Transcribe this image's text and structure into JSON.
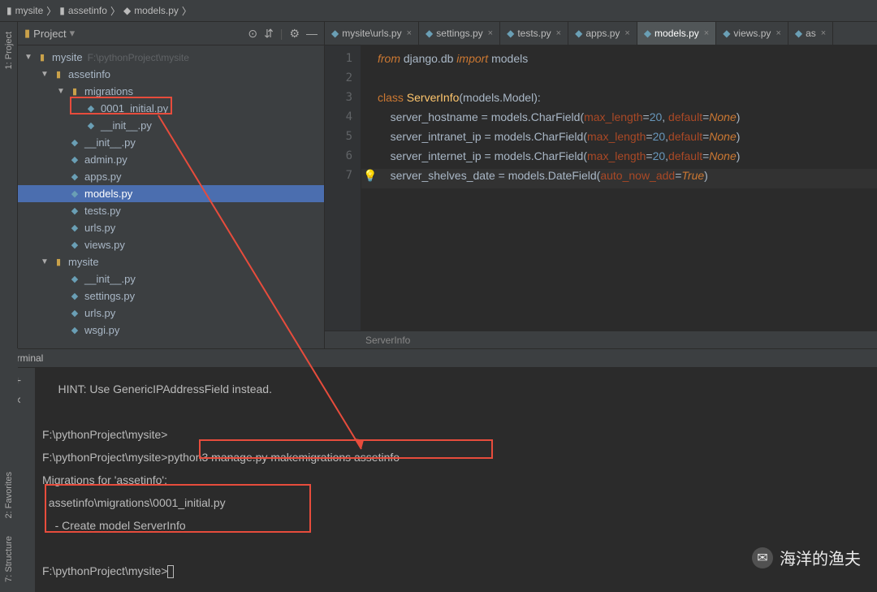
{
  "breadcrumb": [
    "mysite",
    "assetinfo",
    "models.py"
  ],
  "panel": {
    "title": "Project",
    "path_hint": "F:\\pythonProject\\mysite"
  },
  "panel_actions": {
    "target": "⊙",
    "collapse": "⇵",
    "gear": "⚙",
    "min": "—"
  },
  "tree": [
    {
      "d": 1,
      "a": "▼",
      "i": "folder",
      "t": "mysite",
      "hint": "F:\\pythonProject\\mysite"
    },
    {
      "d": 2,
      "a": "▼",
      "i": "folder",
      "t": "assetinfo"
    },
    {
      "d": 3,
      "a": "▼",
      "i": "folder",
      "t": "migrations"
    },
    {
      "d": 4,
      "a": "",
      "i": "py",
      "t": "0001_initial.py",
      "boxed": true
    },
    {
      "d": 4,
      "a": "",
      "i": "py",
      "t": "__init__.py"
    },
    {
      "d": 3,
      "a": "",
      "i": "py",
      "t": "__init__.py"
    },
    {
      "d": 3,
      "a": "",
      "i": "py",
      "t": "admin.py"
    },
    {
      "d": 3,
      "a": "",
      "i": "py",
      "t": "apps.py"
    },
    {
      "d": 3,
      "a": "",
      "i": "py",
      "t": "models.py",
      "sel": true
    },
    {
      "d": 3,
      "a": "",
      "i": "py",
      "t": "tests.py"
    },
    {
      "d": 3,
      "a": "",
      "i": "py",
      "t": "urls.py"
    },
    {
      "d": 3,
      "a": "",
      "i": "py",
      "t": "views.py"
    },
    {
      "d": 2,
      "a": "▼",
      "i": "folder",
      "t": "mysite"
    },
    {
      "d": 3,
      "a": "",
      "i": "py",
      "t": "__init__.py"
    },
    {
      "d": 3,
      "a": "",
      "i": "py",
      "t": "settings.py"
    },
    {
      "d": 3,
      "a": "",
      "i": "py",
      "t": "urls.py"
    },
    {
      "d": 3,
      "a": "",
      "i": "py",
      "t": "wsgi.py"
    }
  ],
  "tabs": [
    {
      "t": "mysite\\urls.py"
    },
    {
      "t": "settings.py"
    },
    {
      "t": "tests.py"
    },
    {
      "t": "apps.py"
    },
    {
      "t": "models.py",
      "active": true
    },
    {
      "t": "views.py"
    },
    {
      "t": "as"
    }
  ],
  "code_lines": 7,
  "code": {
    "l1": {
      "pre": "from ",
      "mod": "django.db ",
      "imp": "import ",
      "name": "models"
    },
    "l3": {
      "cls": "class ",
      "name": "ServerInfo",
      "paren": "(models.Model)",
      ":": ":"
    },
    "l4": {
      "ind": "    ",
      "var": "server_hostname ",
      "eq": "= ",
      "call": "models.",
      "fn": "CharField",
      "open": "(",
      "p1": "max_length",
      "e1": "=",
      "n1": "20",
      "c": ", ",
      "p2": "default",
      "e2": "=",
      "v2": "None",
      "close": ")"
    },
    "l5": {
      "ind": "    ",
      "var": "server_intranet_ip ",
      "eq": "= ",
      "call": "models.",
      "fn": "CharField",
      "open": "(",
      "p1": "max_length",
      "e1": "=",
      "n1": "20",
      "c": ",",
      "p2": "default",
      "e2": "=",
      "v2": "None",
      "close": ")"
    },
    "l6": {
      "ind": "    ",
      "var": "server_internet_ip ",
      "eq": "= ",
      "call": "models.",
      "fn": "CharField",
      "open": "(",
      "p1": "max_length",
      "e1": "=",
      "n1": "20",
      "c": ",",
      "p2": "default",
      "e2": "=",
      "v2": "None",
      "close": ")"
    },
    "l7": {
      "ind": "    ",
      "var": "server_shelves_date ",
      "eq": "= ",
      "call": "models.",
      "fn": "DateField",
      "open": "(",
      "p1": "auto_now_add",
      "e1": "=",
      "v1": "True",
      "close": ")"
    }
  },
  "bottom_crumb": "ServerInfo",
  "terminal": {
    "title": "Terminal",
    "hint": "HINT: Use GenericIPAddressField instead.",
    "prompt1": "F:\\pythonProject\\mysite>",
    "prompt2": "F:\\pythonProject\\mysite>",
    "cmd": "python3 manage.py makemigrations assetinfo",
    "mig_for": "Migrations for 'assetinfo':",
    "mig_file": "assetinfo\\migrations\\0001_initial.py",
    "mig_create": "- Create model ServerInfo",
    "prompt3": "F:\\pythonProject\\mysite>"
  },
  "side_tabs": {
    "project": "1: Project",
    "fav": "2: Favorites",
    "struct": "7: Structure"
  },
  "watermark": "海洋的渔夫"
}
